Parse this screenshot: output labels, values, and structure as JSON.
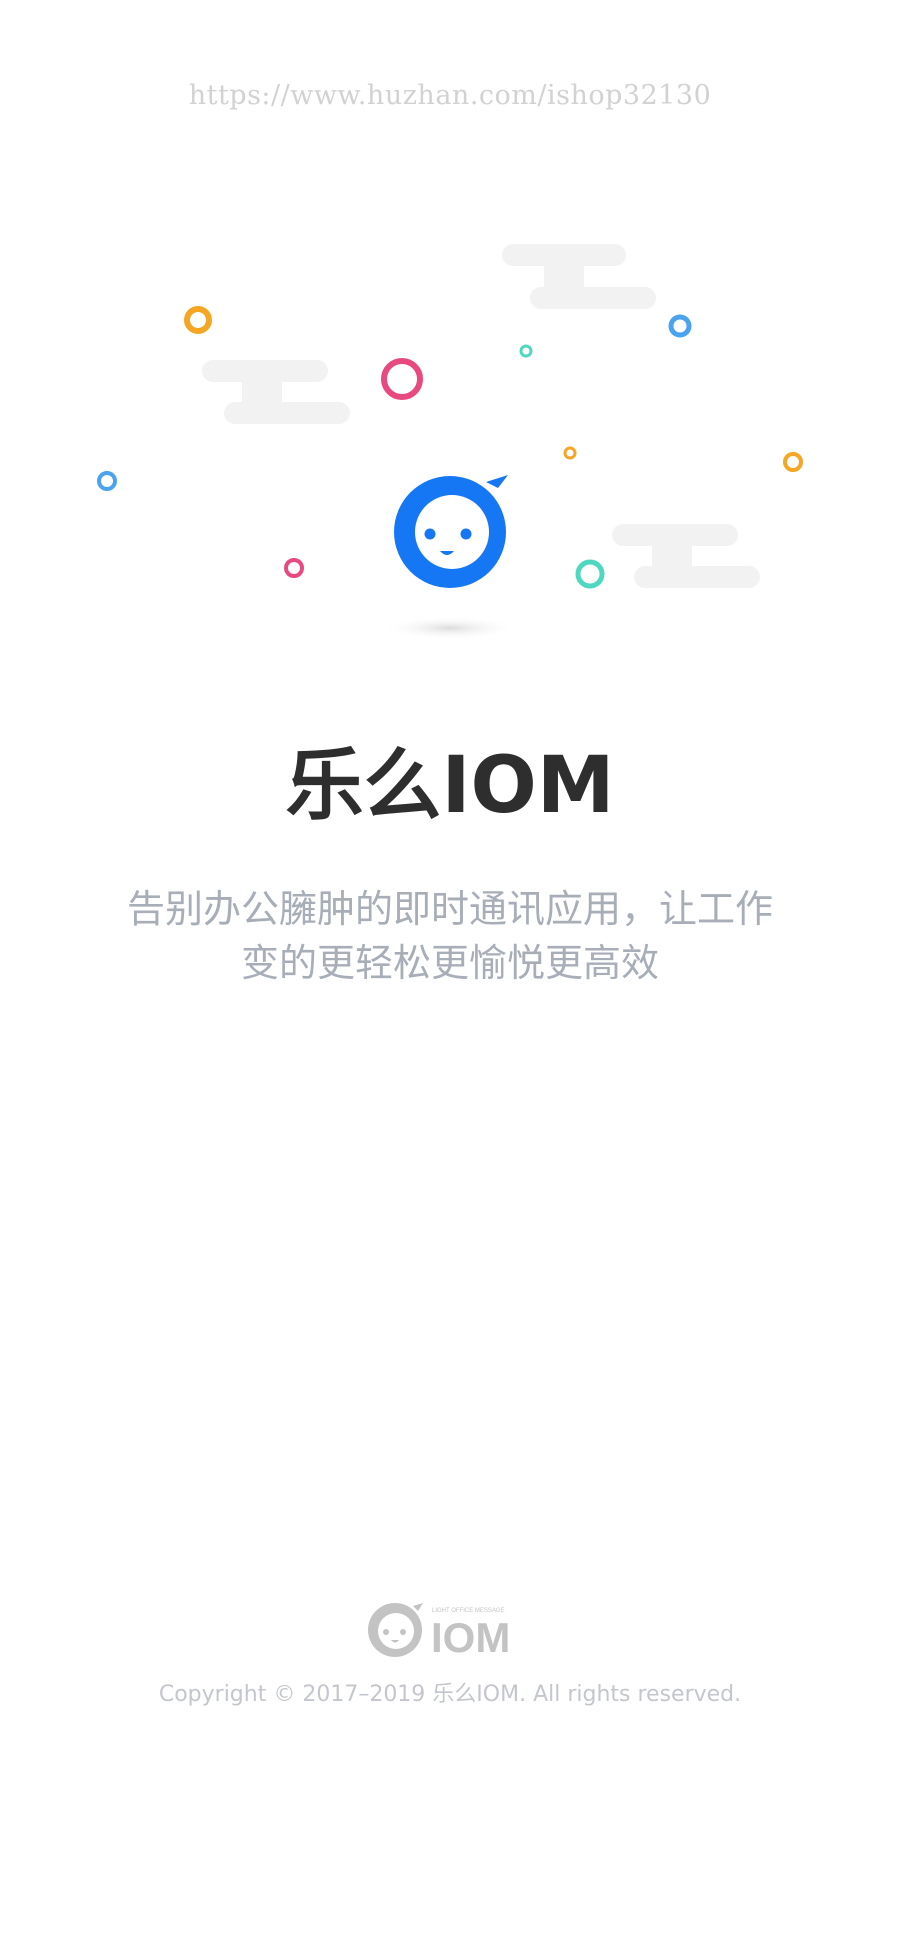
{
  "watermark": "https://www.huzhan.com/ishop32130",
  "app": {
    "title": "乐么IOM",
    "tagline_line1": "告别办公臃肿的即时通讯应用，让工作",
    "tagline_line2": "变的更轻松更愉悦更高效"
  },
  "footer": {
    "logo_small_text": "LIGHT OFFICE MESSAGE",
    "logo_text": "IOM",
    "copyright": "Copyright © 2017–2019 乐么IOM. All rights reserved."
  },
  "colors": {
    "brand_blue": "#1677f5",
    "title": "#2e2e2e",
    "tagline": "#a8aeb8",
    "footer_gray": "#c3c6cc",
    "cloud": "#f2f2f2",
    "orange": "#f5a623",
    "pink": "#e84a7f",
    "light_blue": "#4aa3ef",
    "teal": "#4fd8c0"
  },
  "icons": [
    "mascot-logo-icon",
    "cloud-icon",
    "bubble-ring-icon"
  ]
}
